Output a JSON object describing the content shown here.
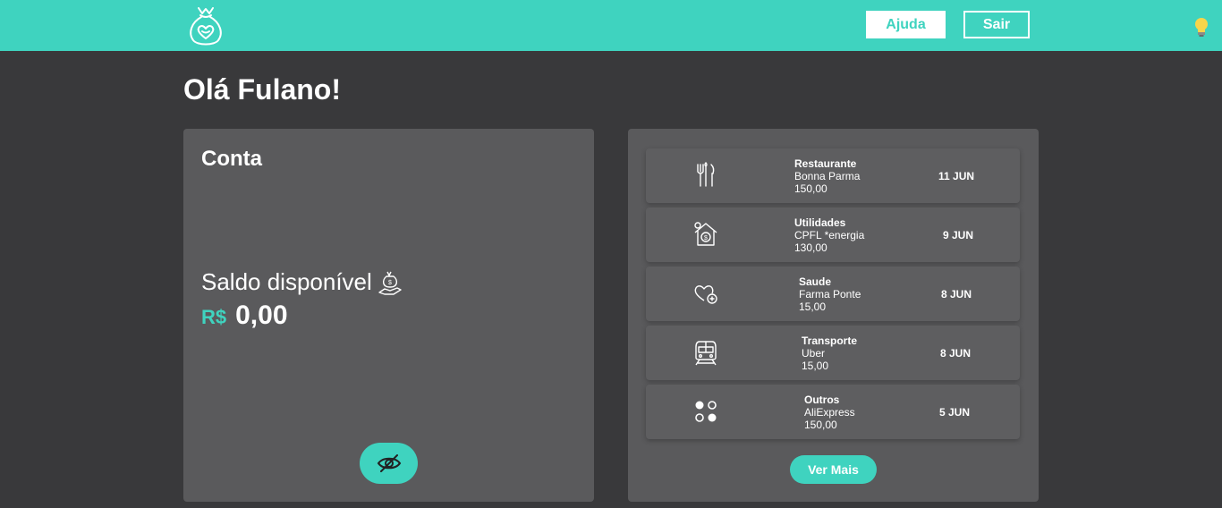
{
  "header": {
    "logo_icon": "money-bag-heart-icon",
    "help_label": "Ajuda",
    "exit_label": "Sair",
    "theme_icon": "lightbulb-icon",
    "accent_color": "#3fd3bf"
  },
  "greeting": "Olá Fulano!",
  "account": {
    "title": "Conta",
    "balance_label": "Saldo disponível",
    "balance_icon": "money-bag-hand-icon",
    "currency": "R$",
    "balance": "0,00",
    "toggle_icon": "eye-slash-icon"
  },
  "transactions": {
    "items": [
      {
        "icon": "cutlery-icon",
        "category": "Restaurante",
        "merchant": "Bonna Parma",
        "amount": "150,00",
        "date": "11 JUN"
      },
      {
        "icon": "house-money-icon",
        "category": "Utilidades",
        "merchant": "CPFL *energia",
        "amount": "130,00",
        "date": "9 JUN"
      },
      {
        "icon": "heart-plus-icon",
        "category": "Saude",
        "merchant": "Farma Ponte",
        "amount": "15,00",
        "date": "8 JUN"
      },
      {
        "icon": "train-icon",
        "category": "Transporte",
        "merchant": "Uber",
        "amount": "15,00",
        "date": "8 JUN"
      },
      {
        "icon": "dots-icon",
        "category": "Outros",
        "merchant": "AliExpress",
        "amount": "150,00",
        "date": "5 JUN"
      }
    ],
    "more_label": "Ver Mais"
  }
}
